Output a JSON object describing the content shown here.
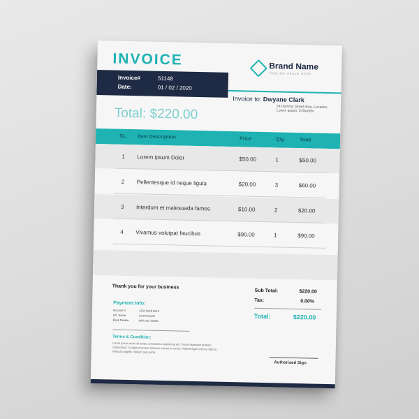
{
  "invoice": {
    "title": "INVOICE",
    "number_label": "Invoice#",
    "number": "51148",
    "date_label": "Date:",
    "date": "01 / 02 / 2020",
    "total_line": "Total: $220.00"
  },
  "brand": {
    "name": "Brand Name",
    "tagline": "TAGLINE SPACE HERE"
  },
  "recipient": {
    "label": "Invoice to:",
    "name": "Dwyane Clark",
    "address": "24 Dummy Street Area, Location, Lorem Ipsum, 570xx59x"
  },
  "table": {
    "headers": [
      "SL.",
      "Item Description",
      "Price",
      "Qty.",
      "Total"
    ],
    "rows": [
      {
        "sl": "1",
        "desc": "Lorem ipsum Dolor",
        "price": "$50.00",
        "qty": "1",
        "total": "$50.00"
      },
      {
        "sl": "2",
        "desc": "Pellentesque id neque ligula",
        "price": "$20.00",
        "qty": "3",
        "total": "$60.00"
      },
      {
        "sl": "3",
        "desc": "Interdum et malesuada fames",
        "price": "$10.00",
        "qty": "2",
        "total": "$20.00"
      },
      {
        "sl": "4",
        "desc": "Vivamus volutpat faucibus",
        "price": "$90.00",
        "qty": "1",
        "total": "$90.00"
      }
    ]
  },
  "footer": {
    "thanks": "Thank you for your business",
    "payment_title": "Payment Info:",
    "payment": [
      {
        "label": "Account #:",
        "value": "1234 5678 9012"
      },
      {
        "label": "A/C Name:",
        "value": "Lorem Ipsum"
      },
      {
        "label": "Bank Details:",
        "value": "Add your details"
      }
    ],
    "terms_title": "Terms & Condition:",
    "terms_text": "Lorem ipsum dolor sit amet, consectetur adipiscing elit. Fusce dignissim pretium consectetur. Curabitur tempor posuere massa in varius. Pellentesque viverra nibh eu vehicula sagittis. Nullam quis porta.",
    "subtotal_label": "Sub Total:",
    "subtotal": "$220.00",
    "tax_label": "Tax:",
    "tax": "0.00%",
    "grand_label": "Total:",
    "grand": "$220.00",
    "signature": "Authorised Sign"
  },
  "colors": {
    "accent": "#1fb2b2",
    "dark": "#1f2a44",
    "background": "#f6f6f6"
  }
}
